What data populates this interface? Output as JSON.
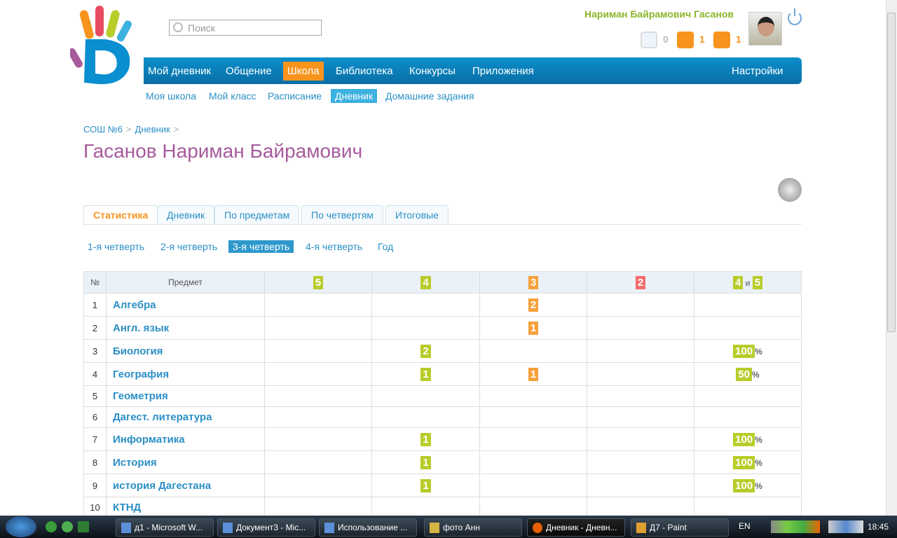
{
  "header": {
    "search_placeholder": "Поиск",
    "user_name": "Нариман Байрамович Гасанов",
    "messages_count": "0",
    "friends_count": "1",
    "groups_count": "1"
  },
  "nav": {
    "items": [
      "Мой дневник",
      "Общение",
      "Школа",
      "Библиотека",
      "Конкурсы",
      "Приложения"
    ],
    "active": "Школа",
    "settings": "Настройки"
  },
  "subnav": {
    "items": [
      "Моя школа",
      "Мой класс",
      "Расписание",
      "Дневник",
      "Домашние задания"
    ],
    "active": "Дневник"
  },
  "breadcrumb": [
    "СОШ №6",
    "Дневник"
  ],
  "page_title": "Гасанов Нариман Байрамович",
  "tabs": [
    "Статистика",
    "Дневник",
    "По предметам",
    "По четвертям",
    "Итоговые"
  ],
  "quarters": [
    "1-я четверть",
    "2-я четверть",
    "3-я четверть",
    "4-я четверть",
    "Год"
  ],
  "table": {
    "headers": {
      "num": "№",
      "subject": "Предмет",
      "g5": "5",
      "g4": "4",
      "g3": "3",
      "g2": "2",
      "g45a": "4",
      "and": "и",
      "g45b": "5"
    },
    "rows": [
      {
        "n": "1",
        "subject": "Алгебра",
        "c5": "",
        "c4": "",
        "c3": "2",
        "c2": "",
        "p": ""
      },
      {
        "n": "2",
        "subject": "Англ. язык",
        "c5": "",
        "c4": "",
        "c3": "1",
        "c2": "",
        "p": ""
      },
      {
        "n": "3",
        "subject": "Биология",
        "c5": "",
        "c4": "2",
        "c3": "",
        "c2": "",
        "p": "100"
      },
      {
        "n": "4",
        "subject": "География",
        "c5": "",
        "c4": "1",
        "c3": "1",
        "c2": "",
        "p": "50"
      },
      {
        "n": "5",
        "subject": "Геометрия",
        "c5": "",
        "c4": "",
        "c3": "",
        "c2": "",
        "p": ""
      },
      {
        "n": "6",
        "subject": "Дагест. литература",
        "c5": "",
        "c4": "",
        "c3": "",
        "c2": "",
        "p": ""
      },
      {
        "n": "7",
        "subject": "Информатика",
        "c5": "",
        "c4": "1",
        "c3": "",
        "c2": "",
        "p": "100"
      },
      {
        "n": "8",
        "subject": "История",
        "c5": "",
        "c4": "1",
        "c3": "",
        "c2": "",
        "p": "100"
      },
      {
        "n": "9",
        "subject": "история Дагестана",
        "c5": "",
        "c4": "1",
        "c3": "",
        "c2": "",
        "p": "100"
      },
      {
        "n": "10",
        "subject": "КТНД",
        "c5": "",
        "c4": "",
        "c3": "",
        "c2": "",
        "p": ""
      }
    ],
    "percent_sign": "%"
  },
  "colors": {
    "accent": "#f7941d",
    "nav": "#0a7fbd",
    "link": "#2b8fc6",
    "title": "#a65b9c",
    "grade_good": "#b8cc2a",
    "grade_3": "#f7a13a",
    "grade_2": "#f36c6c"
  },
  "taskbar": {
    "items": [
      "д1 - Microsoft W...",
      "Документ3 - Mic...",
      "Использование ...",
      "фото Анн",
      "Дневник - Дневн...",
      "Д7 - Paint"
    ],
    "active": "Дневник - Дневн...",
    "lang": "EN",
    "clock": "18:45"
  }
}
